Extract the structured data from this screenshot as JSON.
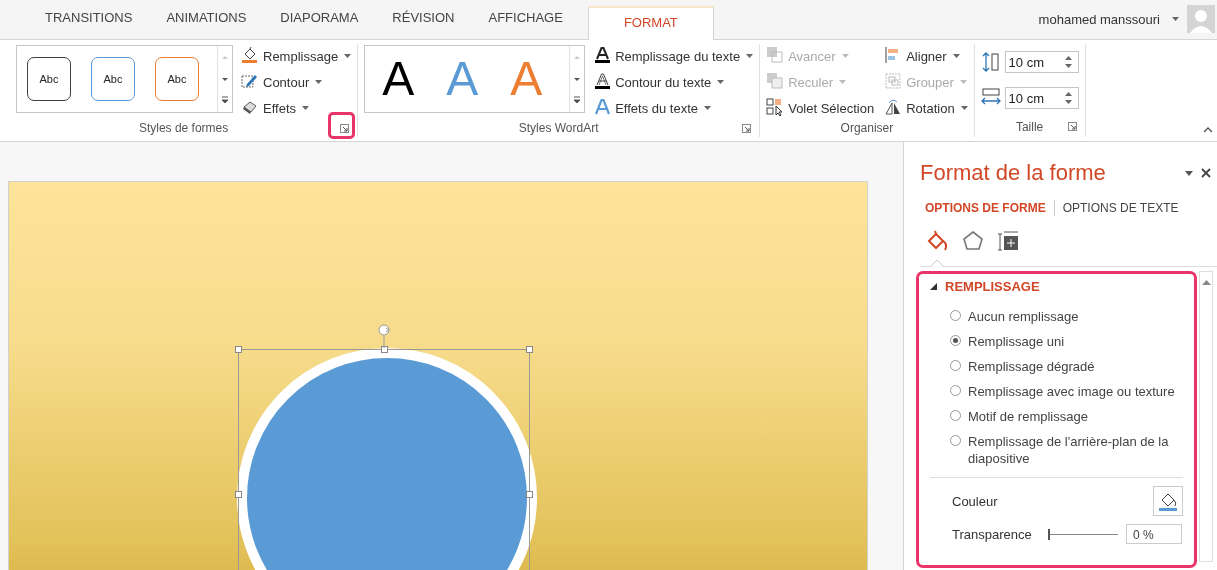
{
  "tabs": [
    {
      "label": "TRANSITIONS",
      "selected": false
    },
    {
      "label": "ANIMATIONS",
      "selected": false
    },
    {
      "label": "DIAPORAMA",
      "selected": false
    },
    {
      "label": "RÉVISION",
      "selected": false
    },
    {
      "label": "AFFICHAGE",
      "selected": false
    },
    {
      "label": "FORMAT",
      "selected": true
    }
  ],
  "user": {
    "name": "mohamed manssouri"
  },
  "ribbon": {
    "groups": [
      {
        "kind": "shape_styles",
        "label": "Styles de formes",
        "highlighted": true,
        "gallery": [
          {
            "text": "Abc",
            "color": "#404040"
          },
          {
            "text": "Abc",
            "color": "#5b9bd5"
          },
          {
            "text": "Abc",
            "color": "#ed7d31"
          }
        ],
        "commands": [
          {
            "label": "Remplissage",
            "disabled": false,
            "dropdown": true
          },
          {
            "label": "Contour",
            "disabled": false,
            "dropdown": true
          },
          {
            "label": "Effets",
            "disabled": false,
            "dropdown": true
          }
        ]
      },
      {
        "kind": "wordart",
        "label": "Styles WordArt",
        "highlighted": false,
        "gallery": [
          {
            "text": "A",
            "color": "#000000"
          },
          {
            "text": "A",
            "color": "#5b9bd5"
          },
          {
            "text": "A",
            "color": "#ed7d31"
          }
        ],
        "commands": [
          {
            "label": "Remplissage du texte",
            "disabled": false,
            "dropdown": true
          },
          {
            "label": "Contour du texte",
            "disabled": false,
            "dropdown": true
          },
          {
            "label": "Effets du texte",
            "disabled": false,
            "dropdown": true
          }
        ]
      },
      {
        "kind": "arrange",
        "label": "Organiser",
        "commands": [
          {
            "label": "Avancer",
            "disabled": true,
            "dropdown": true
          },
          {
            "label": "Reculer",
            "disabled": true,
            "dropdown": true
          },
          {
            "label": "Volet Sélection",
            "disabled": false,
            "dropdown": false
          },
          {
            "label": "Aligner",
            "disabled": false,
            "dropdown": true
          },
          {
            "label": "Grouper",
            "disabled": true,
            "dropdown": true
          },
          {
            "label": "Rotation",
            "disabled": false,
            "dropdown": true
          }
        ]
      },
      {
        "kind": "size",
        "label": "Taille",
        "highlighted": false,
        "fields": [
          {
            "value": "10 cm"
          },
          {
            "value": "10 cm"
          }
        ]
      }
    ]
  },
  "pane": {
    "title": "Format de la forme",
    "tabs": [
      {
        "label": "OPTIONS DE FORME",
        "selected": true
      },
      {
        "label": "OPTIONS DE TEXTE",
        "selected": false
      }
    ],
    "icon_tabs": [
      {
        "selected": true
      },
      {
        "selected": false
      },
      {
        "selected": false
      }
    ],
    "section": {
      "title": "REMPLISSAGE",
      "expanded": true,
      "options": [
        {
          "label": "Aucun remplissage",
          "selected": false
        },
        {
          "label": "Remplissage uni",
          "selected": true
        },
        {
          "label": "Remplissage dégradé",
          "selected": false
        },
        {
          "label": "Remplissage avec image ou texture",
          "selected": false
        },
        {
          "label": "Motif de remplissage",
          "selected": false
        },
        {
          "label": "Remplissage de l'arrière-plan de la diapositive",
          "selected": false
        }
      ],
      "color": {
        "label": "Couleur"
      },
      "transparency": {
        "label": "Transparence",
        "level": 0,
        "value": "0 %"
      }
    }
  }
}
